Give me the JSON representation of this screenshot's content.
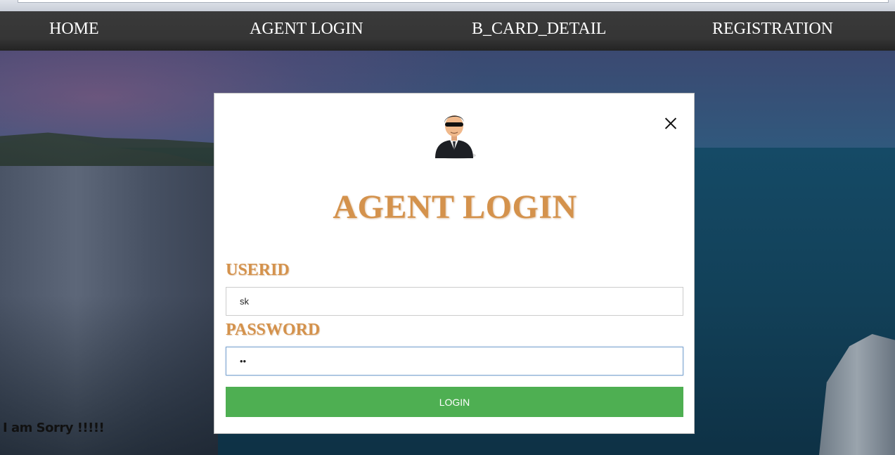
{
  "nav": {
    "items": [
      "HOME",
      "AGENT LOGIN",
      "B_CARD_DETAIL",
      "REGISTRATION"
    ]
  },
  "modal": {
    "title": "AGENT LOGIN",
    "avatar_icon": "agent-avatar-icon",
    "close_icon": "close-icon",
    "userid_label": "USERID",
    "userid_value": "sk",
    "password_label": "PASSWORD",
    "password_value": "••",
    "login_label": "LOGIN"
  },
  "footer_message": "I am Sorry !!!!!",
  "colors": {
    "accent": "#d4924c",
    "login_button": "#4eaf52",
    "navbar": "#353535"
  }
}
